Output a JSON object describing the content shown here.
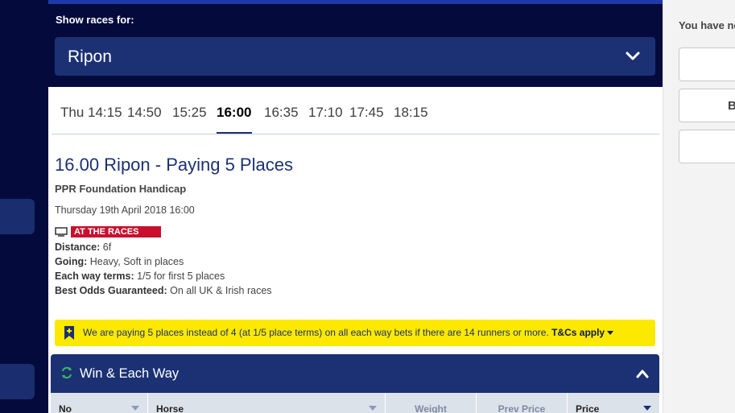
{
  "header": {
    "show_label": "Show races for:",
    "course": "Ripon"
  },
  "times": [
    {
      "label": "Thu 14:15",
      "active": false
    },
    {
      "label": "14:50",
      "active": false
    },
    {
      "label": "15:25",
      "active": false
    },
    {
      "label": "16:00",
      "active": true
    },
    {
      "label": "16:35",
      "active": false
    },
    {
      "label": "17:10",
      "active": false
    },
    {
      "label": "17:45",
      "active": false
    },
    {
      "label": "18:15",
      "active": false
    }
  ],
  "race": {
    "title": "16.00 Ripon - Paying 5 Places",
    "name": "PPR Foundation Handicap",
    "date": "Thursday 19th April 2018 16:00",
    "broadcaster": "AT THE RACES",
    "distance_label": "Distance:",
    "distance": "6f",
    "going_label": "Going:",
    "going": "Heavy, Soft in places",
    "each_way_label": "Each way terms:",
    "each_way": "1/5 for first 5 places",
    "bog_label": "Best Odds Guaranteed:",
    "bog": "On all UK & Irish races"
  },
  "promo": {
    "text": "We are paying 5 places instead of 4 (at 1/5 place terms) on all each way bets if there are 14 runners or more.",
    "link": "T&Cs apply"
  },
  "market": {
    "title": "Win & Each Way"
  },
  "table": {
    "columns": [
      "No",
      "Horse",
      "Weight",
      "Prev Price",
      "Price"
    ]
  },
  "sidebar": {
    "message": "You have no",
    "button_text": "B"
  },
  "colors": {
    "navy_dark": "#040b3c",
    "navy": "#1b3174",
    "promo_yellow": "#fde800"
  }
}
